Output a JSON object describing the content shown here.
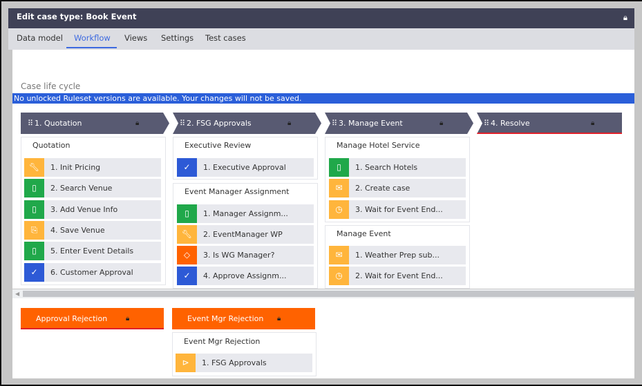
{
  "header": {
    "title": "Edit case type:",
    "case_name": "Book Event",
    "lock_icon": "lock-icon"
  },
  "tabs": [
    {
      "label": "Data model"
    },
    {
      "label": "Workflow",
      "active": true
    },
    {
      "label": "Views"
    },
    {
      "label": "Settings"
    },
    {
      "label": "Test cases"
    }
  ],
  "lifecycle_label": "Case life cycle",
  "warning": "No unlocked Ruleset versions are available. Your changes will not be saved.",
  "colors": {
    "header": "#3f4156",
    "stage": "#585a72",
    "accent": "#3d6ae0",
    "warning": "#2b5fd9",
    "alternate_stage": "#ff6200",
    "green": "#20a84a",
    "yellow": "#ffb53c",
    "blue": "#2d5ad6"
  },
  "stages": [
    {
      "label": "1.  Quotation",
      "processes": [
        {
          "title": "Quotation",
          "steps": [
            {
              "label": "1.  Init Pricing",
              "icon": "wrench",
              "color": "yellow"
            },
            {
              "label": "2.  Search Venue",
              "icon": "clipboard",
              "color": "green"
            },
            {
              "label": "3.  Add Venue Info",
              "icon": "clipboard",
              "color": "green"
            },
            {
              "label": "4.  Save Venue",
              "icon": "save-document",
              "color": "yellow"
            },
            {
              "label": "5.  Enter Event Details",
              "icon": "clipboard",
              "color": "green"
            },
            {
              "label": "6.  Customer Approval",
              "icon": "check",
              "color": "blue"
            }
          ]
        }
      ]
    },
    {
      "label": "2.  FSG Approvals",
      "processes": [
        {
          "title": "Executive Review",
          "steps": [
            {
              "label": "1.  Executive Approval",
              "icon": "check",
              "color": "blue"
            }
          ]
        },
        {
          "title": "Event Manager Assignment",
          "steps": [
            {
              "label": "1.  Manager Assignm...",
              "icon": "clipboard",
              "color": "green"
            },
            {
              "label": "2.  EventManager WP",
              "icon": "wrench",
              "color": "yellow"
            },
            {
              "label": "3.  Is WG Manager?",
              "icon": "decision-diamond",
              "color": "orange"
            },
            {
              "label": "4.  Approve Assignm...",
              "icon": "check",
              "color": "blue"
            }
          ]
        }
      ]
    },
    {
      "label": "3.  Manage Event",
      "processes": [
        {
          "title": "Manage Hotel Service",
          "steps": [
            {
              "label": "1.  Search Hotels",
              "icon": "clipboard",
              "color": "green"
            },
            {
              "label": "2.  Create case",
              "icon": "briefcase",
              "color": "yellow"
            },
            {
              "label": "3.  Wait for Event End...",
              "icon": "clock",
              "color": "yellow"
            }
          ]
        },
        {
          "title": "Manage Event",
          "steps": [
            {
              "label": "1.  Weather Prep sub...",
              "icon": "briefcase",
              "color": "yellow"
            },
            {
              "label": "2.  Wait for Event End...",
              "icon": "clock",
              "color": "yellow"
            }
          ]
        }
      ]
    },
    {
      "label": "4.  Resolve",
      "processes": []
    }
  ],
  "alternate_stages": [
    {
      "label": "Approval Rejection",
      "processes": []
    },
    {
      "label": "Event Mgr Rejection",
      "processes": [
        {
          "title": "Event Mgr Rejection",
          "steps": [
            {
              "label": "1.  FSG Approvals",
              "icon": "change-stage",
              "color": "yellow"
            }
          ]
        }
      ]
    }
  ]
}
